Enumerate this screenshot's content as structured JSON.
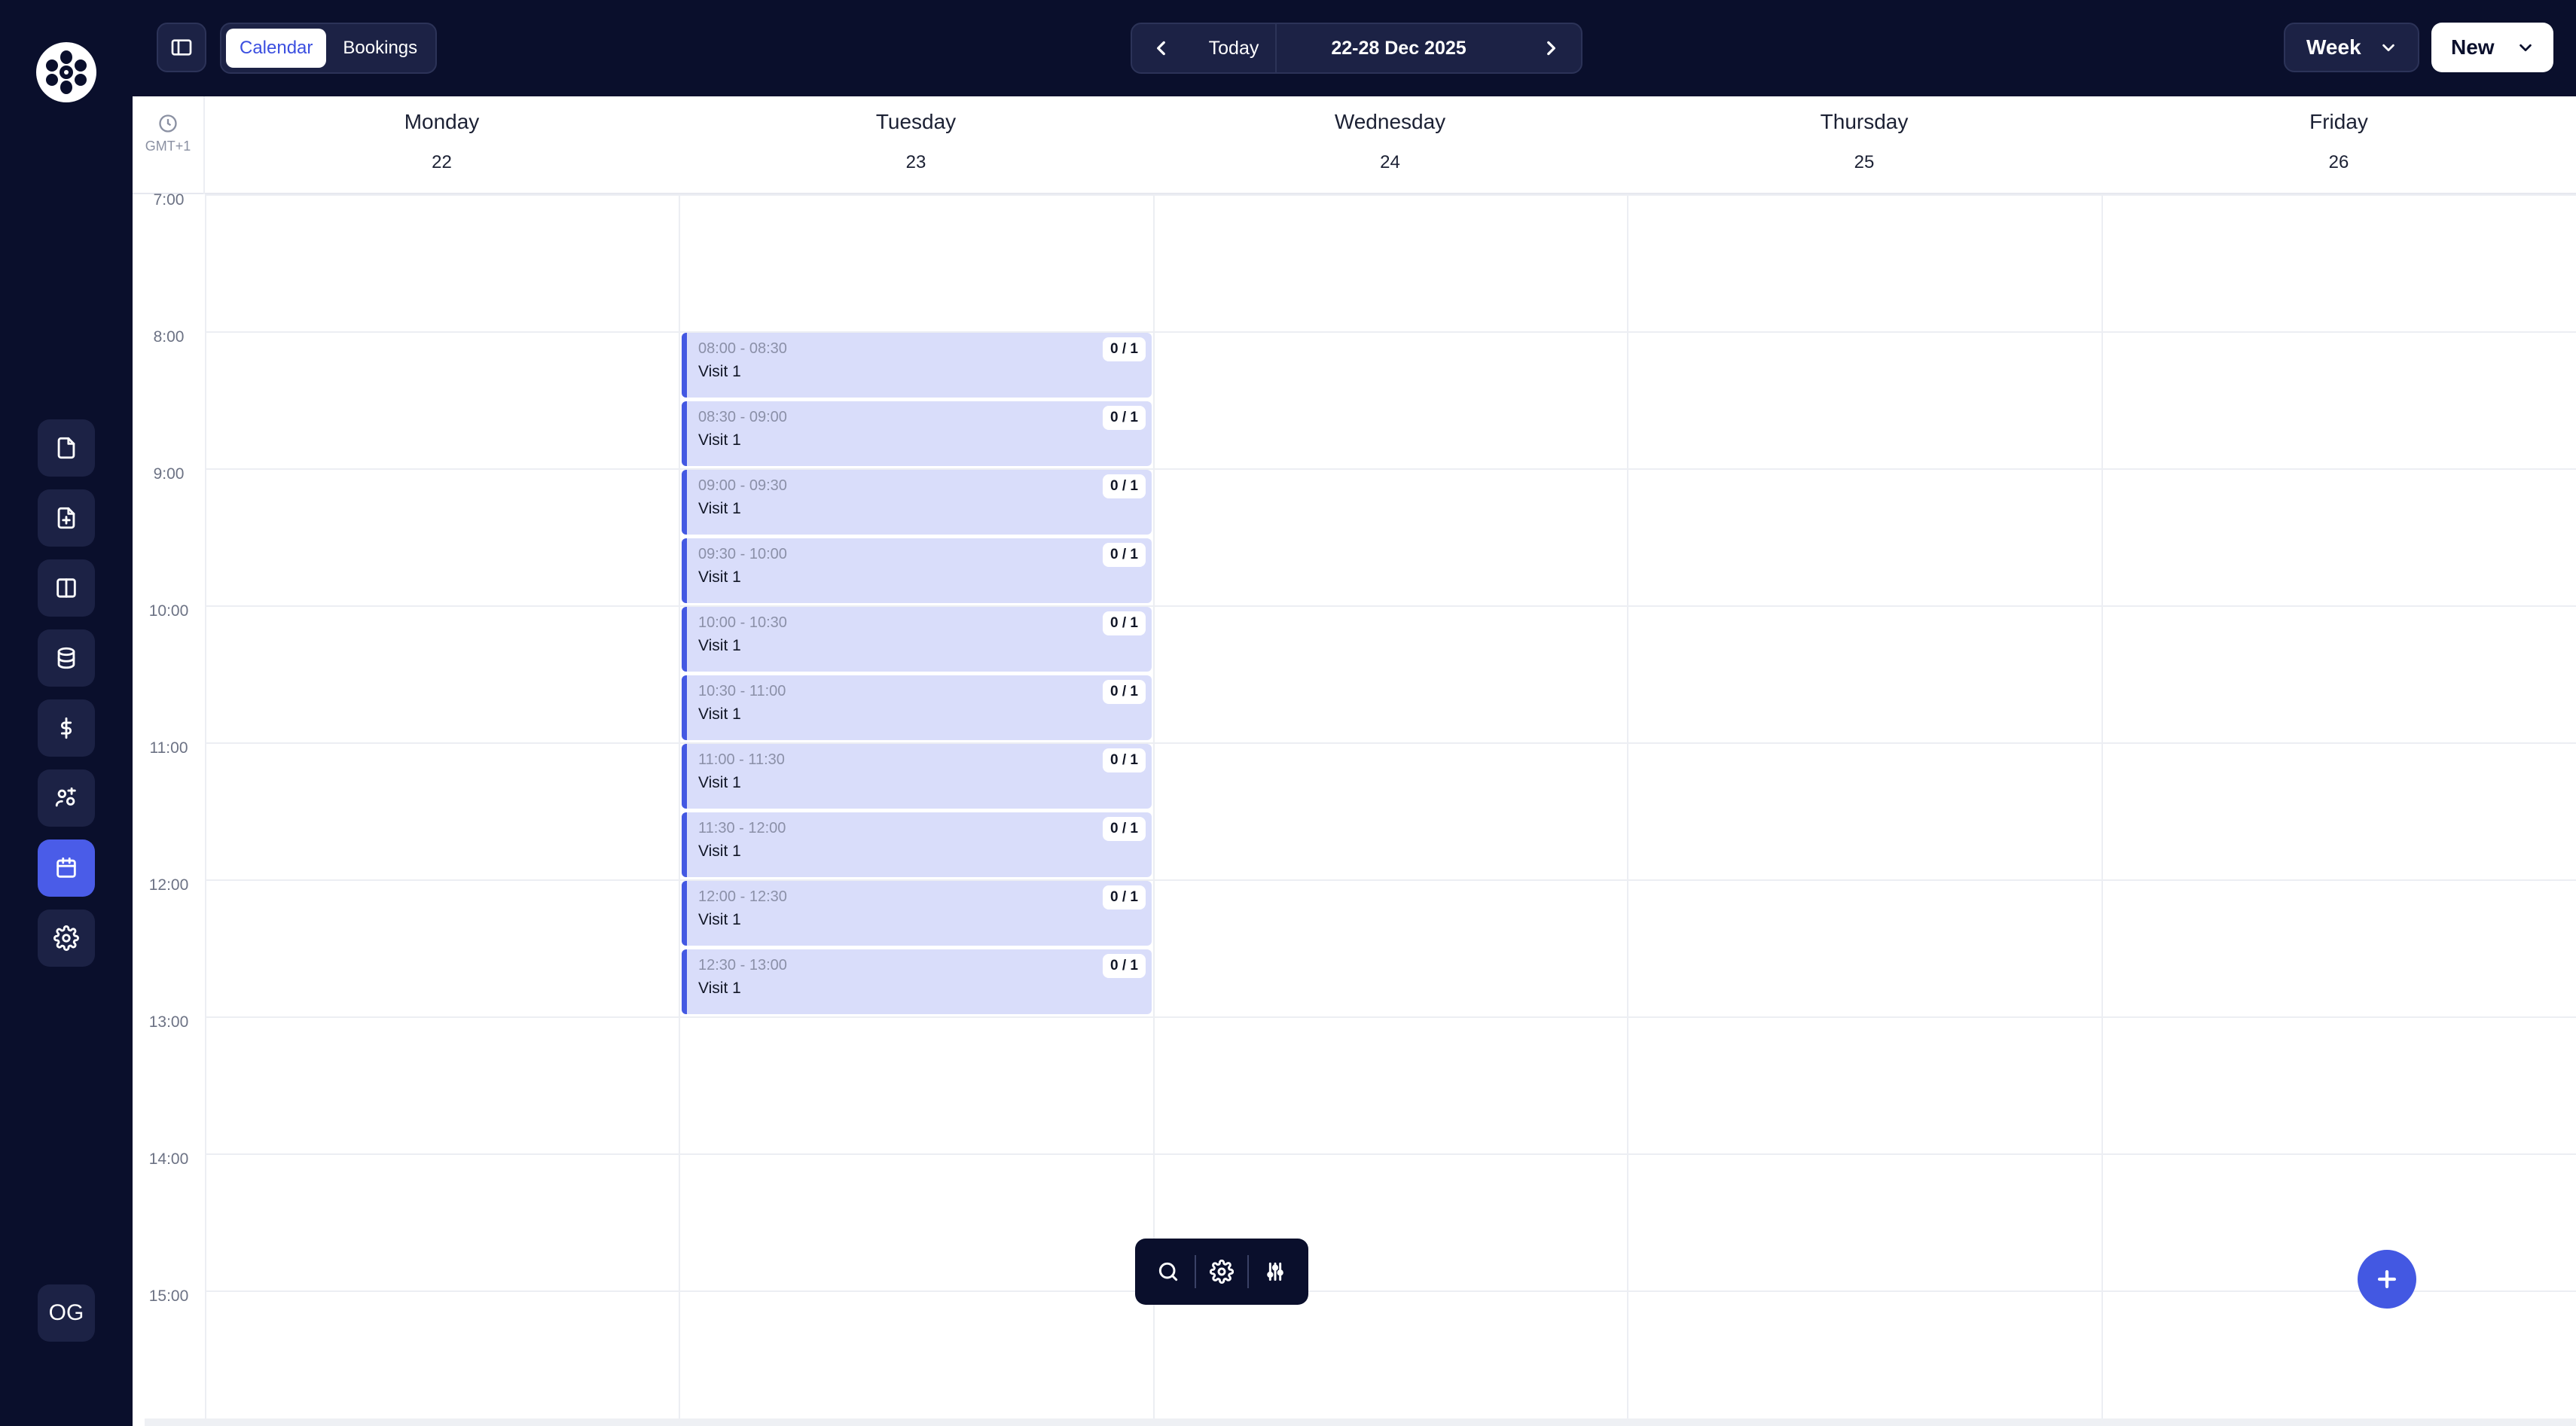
{
  "app": {
    "brand_color": "#0a0f2c",
    "accent_color": "#4358e2"
  },
  "sidebar": {
    "logo_icon": "brand-logo-icon",
    "items": [
      {
        "id": "documents",
        "icon": "file-icon",
        "active": false
      },
      {
        "id": "add-document",
        "icon": "file-plus-icon",
        "active": false
      },
      {
        "id": "panels",
        "icon": "columns-icon",
        "active": false
      },
      {
        "id": "database",
        "icon": "database-icon",
        "active": false
      },
      {
        "id": "billing",
        "icon": "dollar-icon",
        "active": false
      },
      {
        "id": "team",
        "icon": "users-icon",
        "active": false
      },
      {
        "id": "calendar",
        "icon": "calendar-icon",
        "active": true
      },
      {
        "id": "settings",
        "icon": "gear-icon",
        "active": false
      }
    ],
    "user_initials": "OG"
  },
  "topbar": {
    "view_tabs": [
      {
        "label": "Calendar",
        "active": true
      },
      {
        "label": "Bookings",
        "active": false
      }
    ],
    "today_label": "Today",
    "date_range": "22-28 Dec 2025",
    "view_select": "Week",
    "new_label": "New"
  },
  "calendar": {
    "timezone": "GMT+1",
    "days": [
      {
        "name": "Monday",
        "date": "22"
      },
      {
        "name": "Tuesday",
        "date": "23"
      },
      {
        "name": "Wednesday",
        "date": "24"
      },
      {
        "name": "Thursday",
        "date": "25"
      },
      {
        "name": "Friday",
        "date": "26"
      }
    ],
    "hours": [
      "7:00",
      "8:00",
      "9:00",
      "10:00",
      "11:00",
      "12:00",
      "13:00",
      "14:00",
      "15:00"
    ],
    "events": [
      {
        "day": "Tuesday",
        "time": "08:00 - 08:30",
        "title": "Visit 1",
        "capacity": "0 / 1"
      },
      {
        "day": "Tuesday",
        "time": "08:30 - 09:00",
        "title": "Visit 1",
        "capacity": "0 / 1"
      },
      {
        "day": "Tuesday",
        "time": "09:00 - 09:30",
        "title": "Visit 1",
        "capacity": "0 / 1"
      },
      {
        "day": "Tuesday",
        "time": "09:30 - 10:00",
        "title": "Visit 1",
        "capacity": "0 / 1"
      },
      {
        "day": "Tuesday",
        "time": "10:00 - 10:30",
        "title": "Visit 1",
        "capacity": "0 / 1"
      },
      {
        "day": "Tuesday",
        "time": "10:30 - 11:00",
        "title": "Visit 1",
        "capacity": "0 / 1"
      },
      {
        "day": "Tuesday",
        "time": "11:00 - 11:30",
        "title": "Visit 1",
        "capacity": "0 / 1"
      },
      {
        "day": "Tuesday",
        "time": "11:30 - 12:00",
        "title": "Visit 1",
        "capacity": "0 / 1"
      },
      {
        "day": "Tuesday",
        "time": "12:00 - 12:30",
        "title": "Visit 1",
        "capacity": "0 / 1"
      },
      {
        "day": "Tuesday",
        "time": "12:30 - 13:00",
        "title": "Visit 1",
        "capacity": "0 / 1"
      }
    ]
  },
  "floating_toolbar": {
    "tools": [
      "search-icon",
      "gear-icon",
      "sliders-icon"
    ]
  },
  "fab_icon": "plus-icon"
}
